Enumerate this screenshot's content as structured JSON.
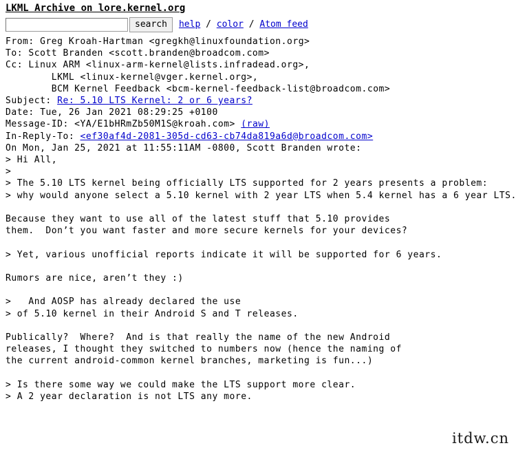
{
  "site": {
    "title": "LKML Archive on lore.kernel.org"
  },
  "search": {
    "value": "",
    "placeholder": "",
    "button_label": "search"
  },
  "nav": {
    "sep": " / ",
    "links": [
      {
        "label": "help"
      },
      {
        "label": "color"
      },
      {
        "label": "Atom feed"
      }
    ]
  },
  "message": {
    "headers": {
      "from_label": "From: ",
      "from_value": "Greg Kroah-Hartman <gregkh@linuxfoundation.org>",
      "to_label": "To: ",
      "to_value": "Scott Branden <scott.branden@broadcom.com>",
      "cc_label": "Cc: ",
      "cc_value_1": "Linux ARM <linux-arm-kernel@lists.infradead.org>,",
      "cc_value_2": "LKML <linux-kernel@vger.kernel.org>,",
      "cc_value_3": "BCM Kernel Feedback <bcm-kernel-feedback-list@broadcom.com>",
      "cc_indent": "        ",
      "subject_label": "Subject: ",
      "subject_value": "Re: 5.10 LTS Kernel: 2 or 6 years?",
      "date_label": "Date: ",
      "date_value": "Tue, 26 Jan 2021 08:29:25 +0100",
      "messageid_label": "Message-ID: ",
      "messageid_value": "<YA/E1bHRmZb50M1S@kroah.com>",
      "raw_label": "(raw)",
      "inreplyto_label": "In-Reply-To: ",
      "inreplyto_value": "<ef30af4d-2081-305d-cd63-cb74da819a6d@broadcom.com>"
    },
    "body_lines": [
      "On Mon, Jan 25, 2021 at 11:55:11AM -0800, Scott Branden wrote:",
      "> Hi All,",
      ">",
      "> The 5.10 LTS kernel being officially LTS supported for 2 years presents a problem:",
      "> why would anyone select a 5.10 kernel with 2 year LTS when 5.4 kernel has a 6 year LTS.",
      "",
      "Because they want to use all of the latest stuff that 5.10 provides",
      "them.  Don’t you want faster and more secure kernels for your devices?",
      "",
      "> Yet, various unofficial reports indicate it will be supported for 6 years.",
      "",
      "Rumors are nice, aren’t they :)",
      "",
      ">   And AOSP has already declared the use",
      "> of 5.10 kernel in their Android S and T releases.",
      "",
      "Publically?  Where?  And is that really the name of the new Android",
      "releases, I thought they switched to numbers now (hence the naming of",
      "the current android-common kernel branches, marketing is fun...)",
      "",
      "> Is there some way we could make the LTS support more clear.",
      "> A 2 year declaration is not LTS any more."
    ]
  },
  "watermark": {
    "text": "itdw.cn"
  },
  "colors": {
    "link": "#0000cc",
    "text": "#000000",
    "background": "#ffffff",
    "button_face": "#efefef"
  }
}
